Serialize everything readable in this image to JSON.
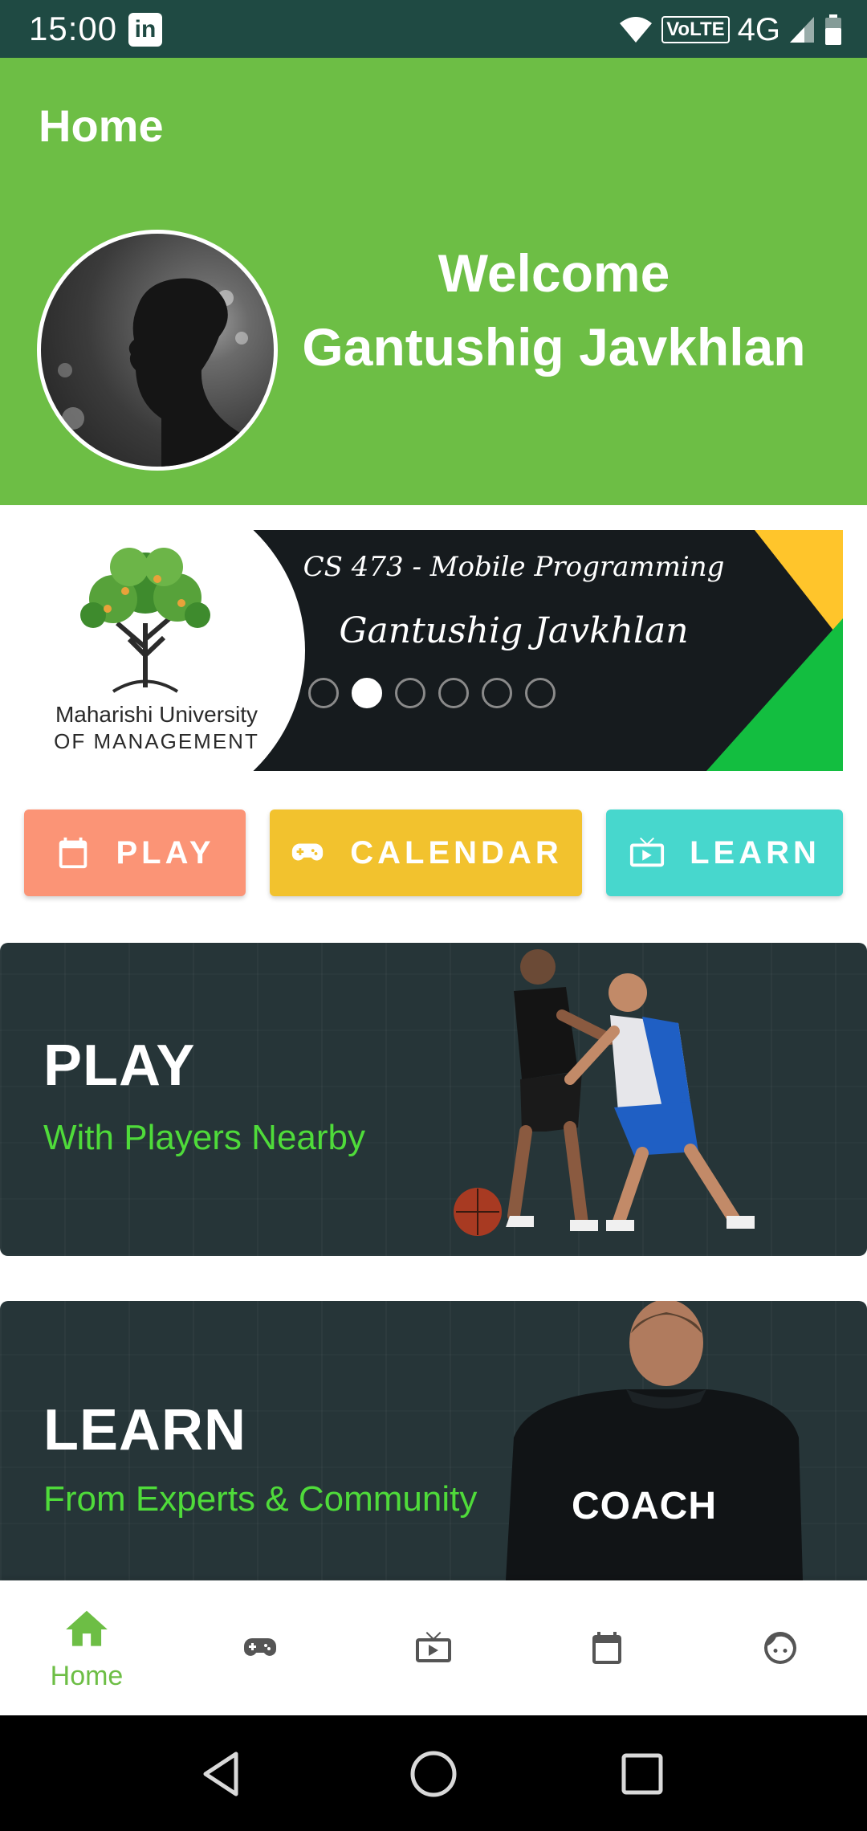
{
  "status_bar": {
    "time": "15:00",
    "app_badge": "in",
    "volte": "VoLTE",
    "network": "4G"
  },
  "header": {
    "title": "Home",
    "welcome_line1": "Welcome",
    "welcome_line2": "Gantushig Javkhlan"
  },
  "banner": {
    "university_line1": "Maharishi University",
    "university_line2": "OF MANAGEMENT",
    "course": "CS 473 - Mobile Programming",
    "name": "Gantushig Javkhlan",
    "slide_count": 6,
    "active_slide": 2
  },
  "buttons": {
    "play": {
      "label": "PLAY",
      "icon": "calendar-icon",
      "color": "#fb9476"
    },
    "calendar": {
      "label": "CALENDAR",
      "icon": "gamepad-icon",
      "color": "#f2c22e"
    },
    "learn": {
      "label": "LEARN",
      "icon": "tv-play-icon",
      "color": "#47d7cd"
    }
  },
  "cards": {
    "play": {
      "title": "PLAY",
      "subtitle": "With Players Nearby"
    },
    "learn": {
      "title": "LEARN",
      "subtitle": "From Experts & Community",
      "shirt_text": "COACH"
    }
  },
  "bottom_nav": {
    "items": [
      {
        "label": "Home",
        "icon": "home-icon",
        "active": true
      },
      {
        "label": "",
        "icon": "gamepad-icon",
        "active": false
      },
      {
        "label": "",
        "icon": "tv-play-icon",
        "active": false
      },
      {
        "label": "",
        "icon": "calendar-icon",
        "active": false
      },
      {
        "label": "",
        "icon": "face-icon",
        "active": false
      }
    ]
  },
  "colors": {
    "primary": "#6dbe45",
    "status_bar": "#1f4a43",
    "accent_green": "#4fdb3a"
  }
}
